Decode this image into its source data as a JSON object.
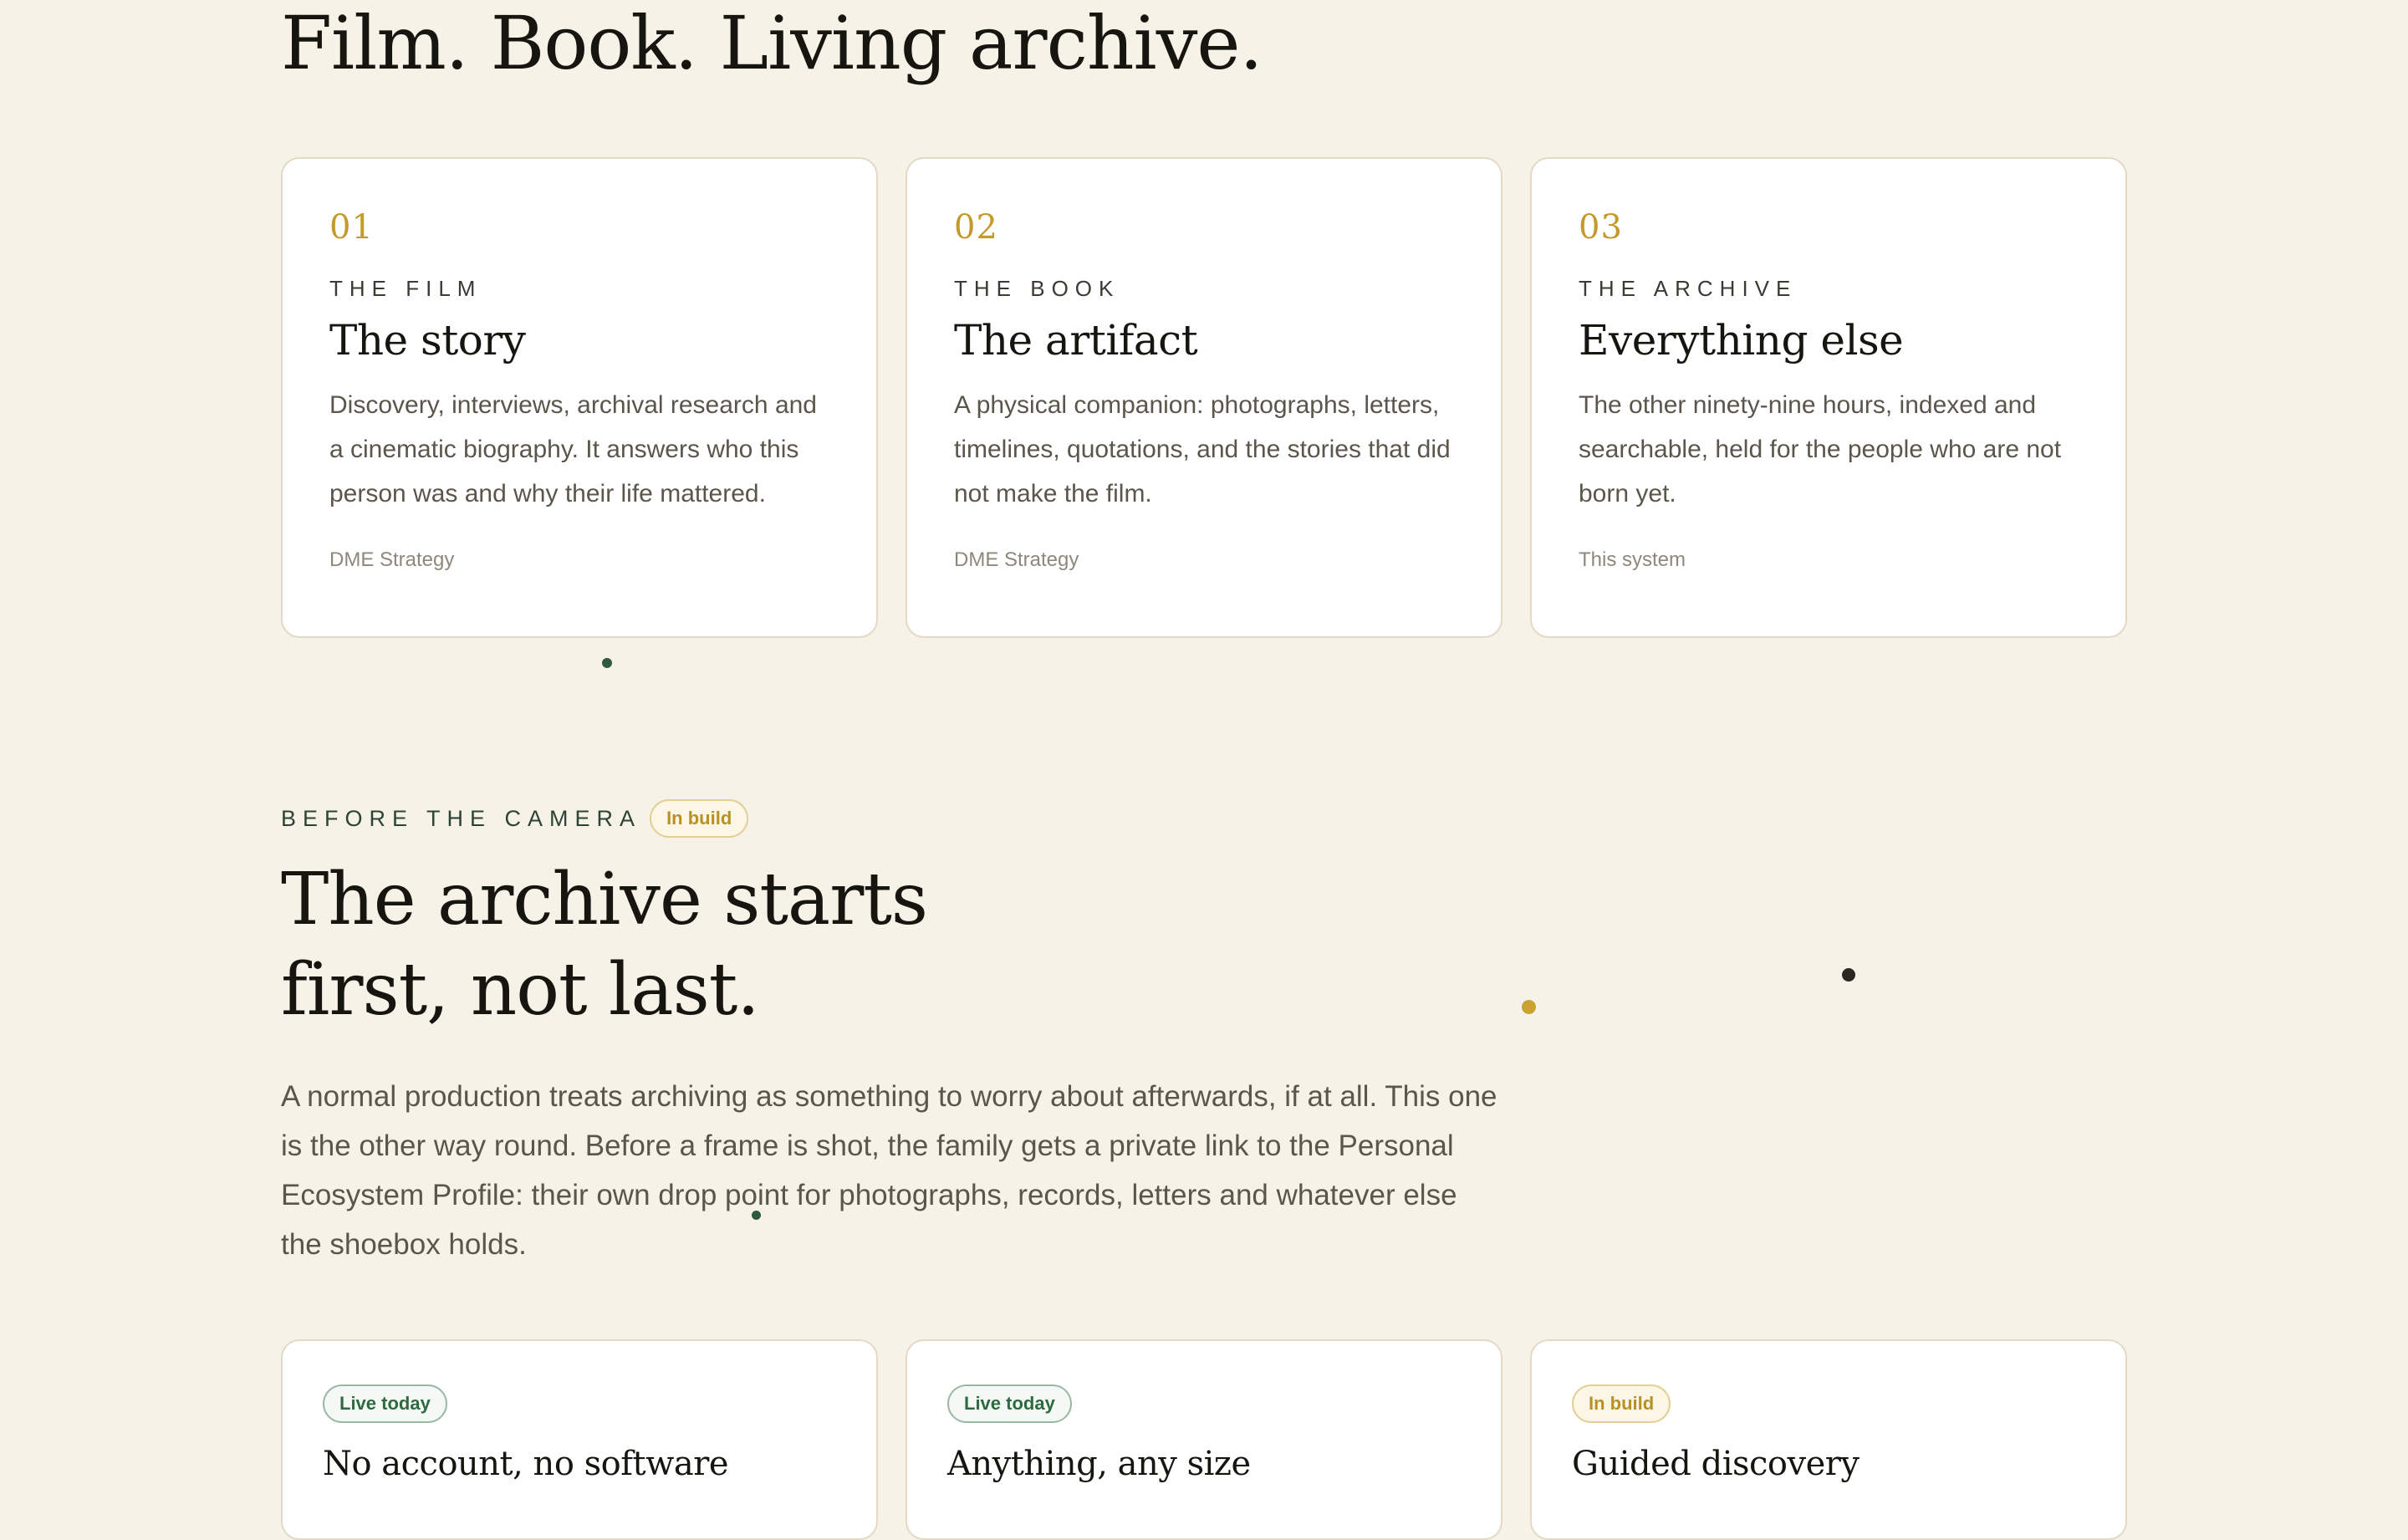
{
  "hero": {
    "title": "Film. Book. Living archive."
  },
  "pillars": [
    {
      "number": "01",
      "eyebrow": "THE FILM",
      "title": "The story",
      "body": "Discovery, interviews, archival research and a cinematic biography. It answers who this person was and why their life mattered.",
      "source": "DME Strategy"
    },
    {
      "number": "02",
      "eyebrow": "THE BOOK",
      "title": "The artifact",
      "body": "A physical companion: photographs, letters, timelines, quotations, and the stories that did not make the film.",
      "source": "DME Strategy"
    },
    {
      "number": "03",
      "eyebrow": "THE ARCHIVE",
      "title": "Everything else",
      "body": "The other ninety-nine hours, indexed and searchable, held for the people who are not born yet.",
      "source": "This system"
    }
  ],
  "section": {
    "eyebrow": "BEFORE THE CAMERA",
    "badge": "In build",
    "title_line1": "The archive starts",
    "title_line2": "first, not last.",
    "body": "A normal production treats archiving as something to worry about afterwards, if at all. This one is the other way round. Before a frame is shot, the family gets a private link to the Personal Ecosystem Profile: their own drop point for photographs, records, letters and whatever else the shoebox holds."
  },
  "features": [
    {
      "badge": "Live today",
      "status": "live",
      "title": "No account, no software"
    },
    {
      "badge": "Live today",
      "status": "live",
      "title": "Anything, any size"
    },
    {
      "badge": "In build",
      "status": "build",
      "title": "Guided discovery"
    }
  ],
  "colors": {
    "background": "#f6f2e8",
    "accent_gold": "#c29a2d",
    "accent_green": "#2d6a40",
    "dark_dot": "#2a2722",
    "green_dot": "#2f5a40"
  }
}
